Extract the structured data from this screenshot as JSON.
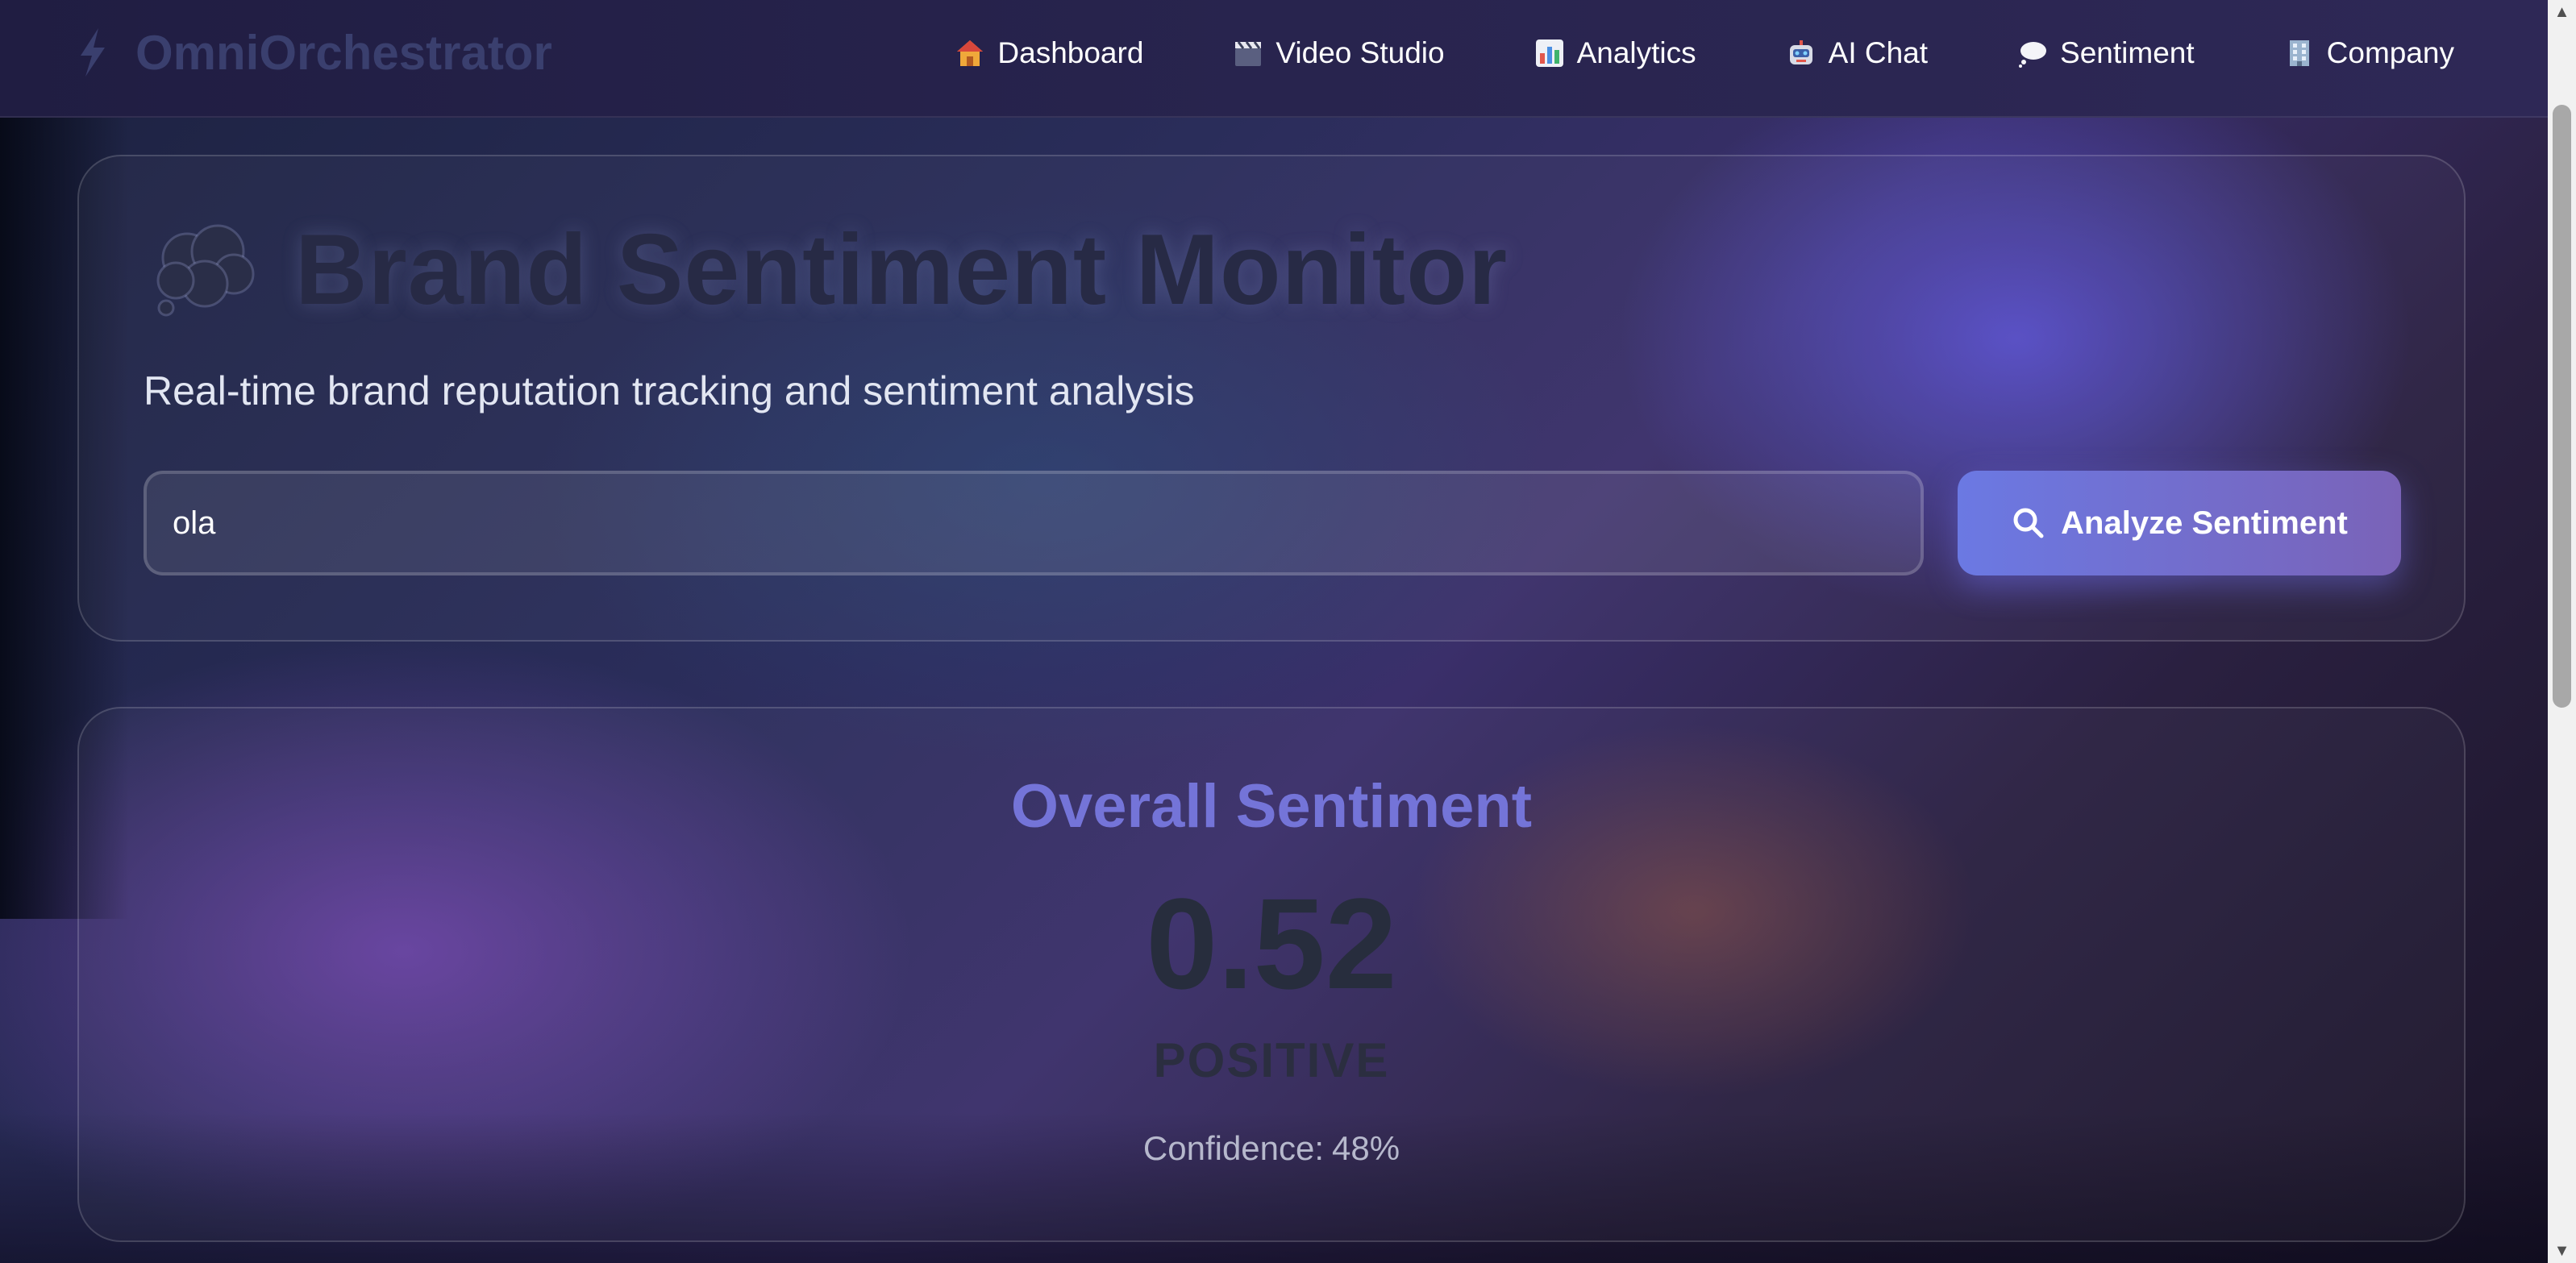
{
  "app": {
    "name": "OmniOrchestrator",
    "icon": "lightning-bolt-icon"
  },
  "nav": {
    "items": [
      {
        "label": "Dashboard",
        "icon": "house-icon"
      },
      {
        "label": "Video Studio",
        "icon": "clapperboard-icon"
      },
      {
        "label": "Analytics",
        "icon": "bar-chart-icon"
      },
      {
        "label": "AI Chat",
        "icon": "robot-icon"
      },
      {
        "label": "Sentiment",
        "icon": "speech-bubble-icon"
      },
      {
        "label": "Company",
        "icon": "office-building-icon"
      }
    ]
  },
  "hero": {
    "title": "Brand Sentiment Monitor",
    "title_icon": "thought-bubble-icon",
    "subtitle": "Real-time brand reputation tracking and sentiment analysis",
    "search_value": "ola",
    "analyze_label": "Analyze Sentiment"
  },
  "result": {
    "title": "Overall Sentiment",
    "score": "0.52",
    "label": "POSITIVE",
    "confidence_label": "Confidence:",
    "confidence_value": "48%"
  },
  "colors": {
    "accent": "#7474d8",
    "button_start": "#6b79e3",
    "button_end": "#7a63b8"
  }
}
